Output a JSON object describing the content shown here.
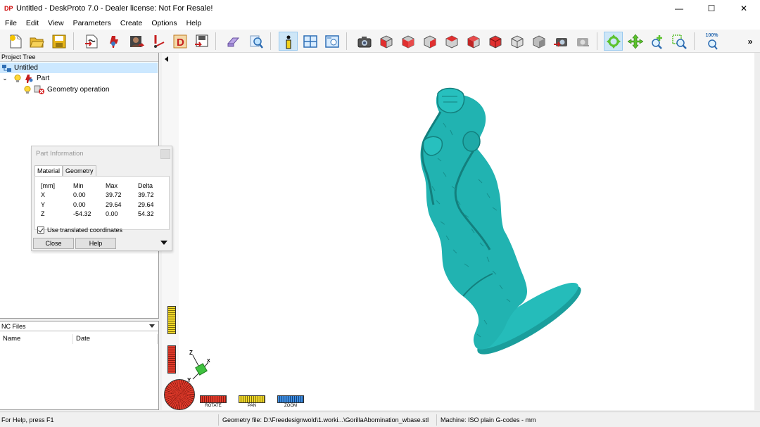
{
  "window": {
    "app_icon": "DP",
    "title": "Untitled - DeskProto 7.0 - Dealer license: Not For Resale!",
    "minimize": "—",
    "maximize": "☐",
    "close": "✕"
  },
  "menu": [
    "File",
    "Edit",
    "View",
    "Parameters",
    "Create",
    "Options",
    "Help"
  ],
  "toolbar": {
    "zoom_percent": "100%",
    "overflow": "»",
    "active_button": "info-button"
  },
  "project_tree": {
    "header": "Project Tree",
    "root": "Untitled",
    "part": "Part",
    "operation": "Geometry operation"
  },
  "part_info": {
    "title": "Part Information",
    "tabs": [
      "Material",
      "Geometry"
    ],
    "selected_tab": "Material",
    "headers": [
      "[mm]",
      "Min",
      "Max",
      "Delta"
    ],
    "rows": [
      [
        "X",
        "0.00",
        "39.72",
        "39.72"
      ],
      [
        "Y",
        "0.00",
        "29.64",
        "29.64"
      ],
      [
        "Z",
        "-54.32",
        "0.00",
        "54.32"
      ]
    ],
    "checkbox_label": "Use translated coordinates",
    "checkbox_checked": true,
    "close_label": "Close",
    "help_label": "Help"
  },
  "nc_files": {
    "header": "NC Files",
    "columns": [
      "Name",
      "Date"
    ]
  },
  "viewport": {
    "model_color": "#21b3b1",
    "axis_z": "Z",
    "axis_y": "Y",
    "axis_x": "X",
    "modes": [
      "ROTATE",
      "PAN",
      "ZOOM"
    ]
  },
  "status": {
    "help": "For Help, press F1",
    "geometry_file": "Geometry file: D:\\Freedesignwold\\1.worki...\\GorillaAbomination_wbase.stl",
    "machine": "Machine: ISO plain G-codes - mm"
  }
}
